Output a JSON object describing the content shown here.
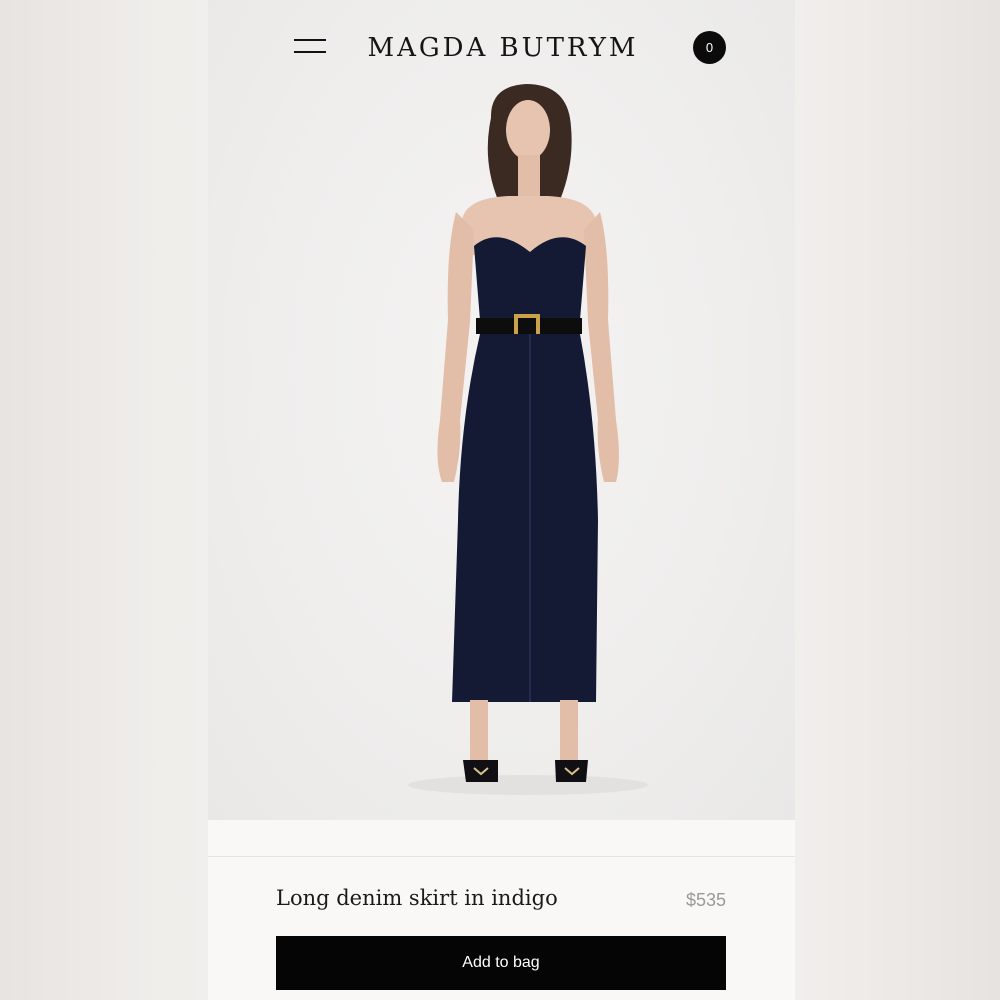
{
  "header": {
    "brand": "MAGDA BUTRYM",
    "menu_icon": "hamburger-menu-icon",
    "cart_count": "0"
  },
  "product": {
    "name": "Long denim skirt in indigo",
    "price": "$535",
    "add_to_bag_label": "Add to bag"
  },
  "colors": {
    "accent": "#000000",
    "background": "#f9f8f6",
    "price_text": "#9a9a9a",
    "garment": "#141a33"
  }
}
